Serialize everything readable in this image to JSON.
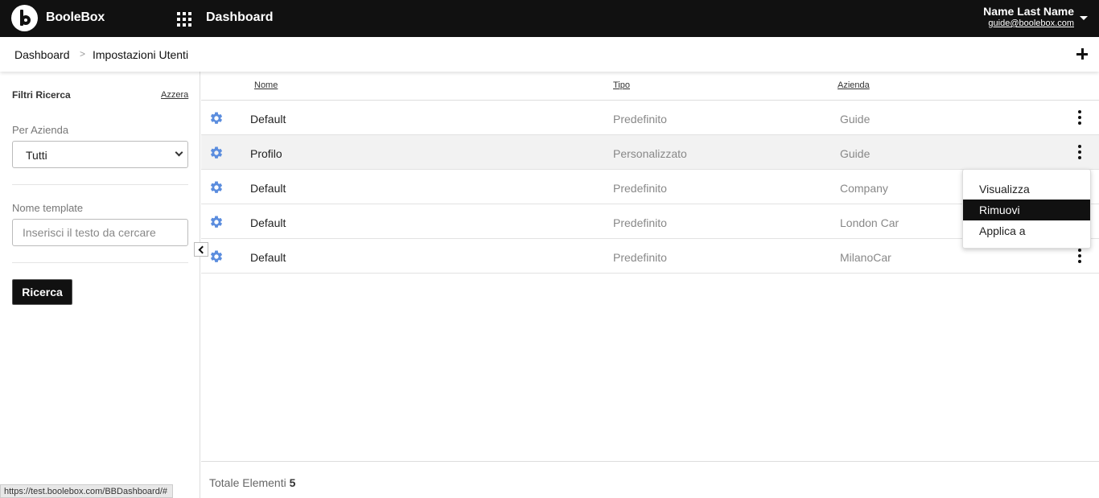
{
  "topbar": {
    "brand": "BooleBox",
    "title": "Dashboard",
    "user_name": "Name Last Name",
    "user_email": "guide@boolebox.com"
  },
  "breadcrumb": {
    "home": "Dashboard",
    "separator": ">",
    "current": "Impostazioni Utenti"
  },
  "sidebar": {
    "title": "Filtri Ricerca",
    "reset": "Azzera",
    "company_label": "Per Azienda",
    "company_value": "Tutti",
    "template_label": "Nome template",
    "template_placeholder": "Inserisci il testo da cercare",
    "search_button": "Ricerca"
  },
  "table": {
    "columns": {
      "name": "Nome",
      "type": "Tipo",
      "company": "Azienda"
    },
    "rows": [
      {
        "name": "Default",
        "type": "Predefinito",
        "company": "Guide"
      },
      {
        "name": "Profilo",
        "type": "Personalizzato",
        "company": "Guide"
      },
      {
        "name": "Default",
        "type": "Predefinito",
        "company": "Company"
      },
      {
        "name": "Default",
        "type": "Predefinito",
        "company": "London Car"
      },
      {
        "name": "Default",
        "type": "Predefinito",
        "company": "MilanoCar"
      }
    ]
  },
  "context_menu": {
    "items": [
      "Visualizza",
      "Rimuovi",
      "Applica a"
    ],
    "active": "Rimuovi"
  },
  "footer": {
    "total_label": "Totale Elementi",
    "total_value": "5"
  },
  "status_bar": {
    "url": "https://test.boolebox.com/BBDashboard/#"
  },
  "colors": {
    "topbar": "#111111",
    "gear_icon": "#5b8dde",
    "highlight_row": "#f2f2f2"
  }
}
